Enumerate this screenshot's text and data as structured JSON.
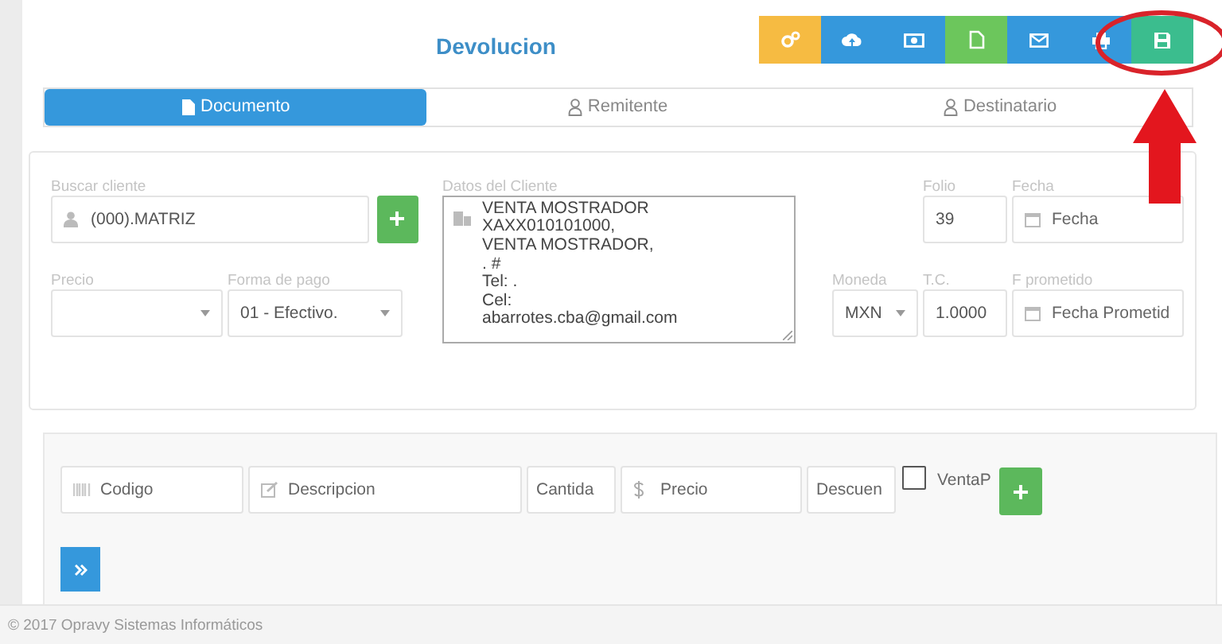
{
  "title": "Devolucion",
  "toolbar": [
    {
      "color": "#f6bb42"
    },
    {
      "color": "#3598dc"
    },
    {
      "color": "#3598dc"
    },
    {
      "color": "#6cc65c"
    },
    {
      "color": "#3598dc"
    },
    {
      "color": "#3598dc"
    },
    {
      "color": "#3bbd8e"
    }
  ],
  "tabs": [
    {
      "label": "Documento",
      "selected": true
    },
    {
      "label": "Remitente",
      "selected": false
    },
    {
      "label": "Destinatario",
      "selected": false
    }
  ],
  "form": {
    "buscar_cliente": {
      "label": "Buscar cliente",
      "value": "(000).MATRIZ"
    },
    "datos_cliente": {
      "label": "Datos del Cliente",
      "lines": [
        "VENTA MOSTRADOR",
        "XAXX010101000,",
        "VENTA MOSTRADOR,",
        ". #",
        "Tel: .",
        "Cel:",
        "abarrotes.cba@gmail.com"
      ]
    },
    "folio": {
      "label": "Folio",
      "value": "39"
    },
    "fecha": {
      "label": "Fecha",
      "placeholder": "Fecha"
    },
    "precio": {
      "label": "Precio"
    },
    "forma_pago": {
      "label": "Forma de pago",
      "value": "01 - Efectivo."
    },
    "moneda": {
      "label": "Moneda",
      "value": "MXN"
    },
    "tc": {
      "label": "T.C.",
      "value": "1.0000"
    },
    "f_prometido": {
      "label": "F prometido",
      "placeholder": "Fecha Prometid"
    }
  },
  "items": {
    "fields": [
      {
        "kind": "barcode",
        "placeholder": "Codigo"
      },
      {
        "kind": "edit",
        "placeholder": "Descripcion"
      },
      {
        "kind": "plain",
        "placeholder": "Cantida"
      },
      {
        "kind": "dollar",
        "placeholder": "Precio"
      },
      {
        "kind": "plain",
        "placeholder": "Descuen"
      }
    ],
    "checkbox": {
      "label": "VentaP",
      "checked": false
    }
  },
  "footer": "© 2017 Opravy Sistemas Informáticos"
}
